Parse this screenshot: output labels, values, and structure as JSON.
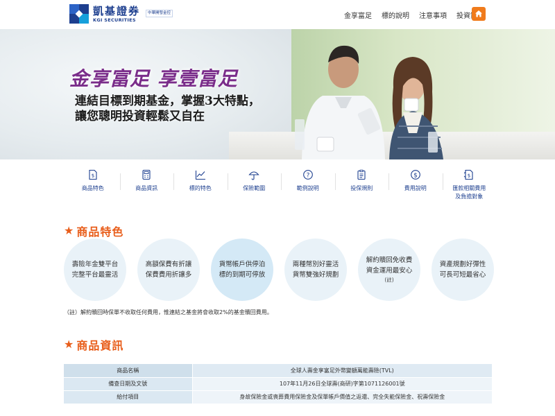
{
  "header": {
    "brand_cn": "凱基證券",
    "brand_en": "KGI SECURITIES",
    "brand_sub": "中華開發金控",
    "nav": [
      "金享富足",
      "標的說明",
      "注意事項",
      "投資策略"
    ],
    "home_icon": "home-icon",
    "accent_color": "#f07b1c"
  },
  "hero": {
    "title": "金享富足 享壹富足",
    "subtitle_lines": [
      "連結目標到期基金，掌握3大特點，",
      "讓您聰明投資輕鬆又自在"
    ]
  },
  "icon_nav": [
    {
      "label": "商品特色",
      "icon": "document-dollar-icon"
    },
    {
      "label": "商品資訊",
      "icon": "calculator-icon"
    },
    {
      "label": "標的特色",
      "icon": "line-chart-icon"
    },
    {
      "label": "保險範圍",
      "icon": "umbrella-icon"
    },
    {
      "label": "範例說明",
      "icon": "question-icon"
    },
    {
      "label": "投保規則",
      "icon": "clipboard-icon"
    },
    {
      "label": "費用說明",
      "icon": "dollar-icon"
    },
    {
      "label": "匯款相關費用",
      "label2": "及負擔對象",
      "icon": "exchange-icon"
    }
  ],
  "features_section": {
    "title": "商品特色",
    "items": [
      {
        "line1": "壽險年金雙平台",
        "line2": "完整平台最靈活"
      },
      {
        "line1": "高額保費有折讓",
        "line2": "保費費用折讓多"
      },
      {
        "line1": "貨幣帳戶供停泊",
        "line2": "標的到期可停放"
      },
      {
        "line1": "兩種幣別好靈活",
        "line2": "貨幣雙強好規劃"
      },
      {
        "line1": "解約贖回免收費",
        "line2": "資金運用最安心",
        "note": "(註)"
      },
      {
        "line1": "資產規劃好彈性",
        "line2": "可長可短最省心"
      }
    ],
    "footnote": "（註）解約贖回時保單不收取任何費用，惟連結之基金將會收取2%的基金贖回費用。"
  },
  "info_section": {
    "title": "商品資訊",
    "rows": [
      {
        "key": "商品名稱",
        "value": "全球人壽金享富足外幣變額萬能壽險(TVL)"
      },
      {
        "key": "備查日期及文號",
        "value": "107年11月26日全球壽(商研)字第1071126001號"
      },
      {
        "key": "給付項目",
        "value": "身故保險金或喪葬費用保險金及保單帳戶價值之返還、完全失能保險金、祝壽保險金"
      }
    ]
  },
  "colors": {
    "section_title": "#e85d1a",
    "brand_blue": "#1d3f8f",
    "hero_title": "#7a2d8a"
  }
}
